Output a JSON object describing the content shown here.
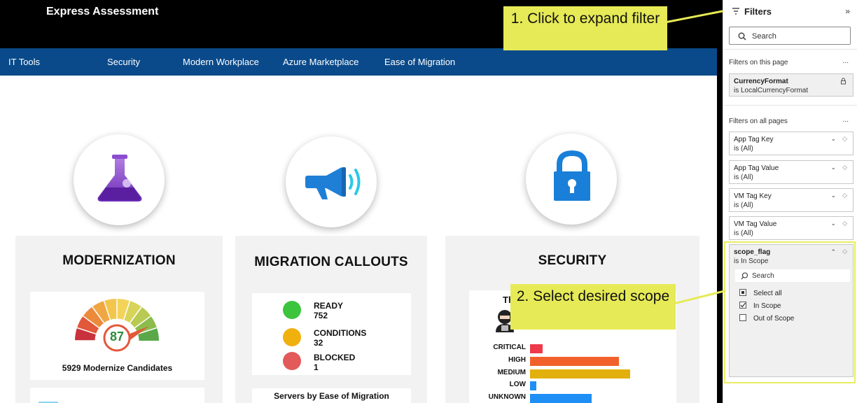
{
  "report": {
    "title": "Express Assessment",
    "nav": [
      "IT Tools",
      "Security",
      "Modern Workplace",
      "Azure Marketplace",
      "Ease of Migration"
    ],
    "modernization": {
      "title": "MODERNIZATION",
      "gauge_value": "87",
      "candidates_label": "5929 Modernize Candidates"
    },
    "migration": {
      "title": "MIGRATION CALLOUTS",
      "items": [
        {
          "label": "READY",
          "value": "752",
          "color": "#3cc43c"
        },
        {
          "label": "CONDITIONS",
          "value": "32",
          "color": "#f0b10f"
        },
        {
          "label": "BLOCKED",
          "value": "1",
          "color": "#e25a5a"
        }
      ],
      "footer": "Servers by Ease of Migration"
    },
    "security": {
      "title": "SECURITY",
      "partial_text": "Th",
      "bars": [
        {
          "label": "CRITICAL",
          "value": 18,
          "color": "#ee3a4b"
        },
        {
          "label": "HIGH",
          "value": 127,
          "color": "#f2612b"
        },
        {
          "label": "MEDIUM",
          "value": 143,
          "color": "#e2b00c"
        },
        {
          "label": "LOW",
          "value": 9,
          "color": "#1f8ef5"
        },
        {
          "label": "UNKNOWN",
          "value": 88,
          "color": "#1f8ef5"
        }
      ]
    },
    "colors": {
      "topbar": "#000000",
      "navbar": "#0a4a8a",
      "card_bg": "#f2f2f2"
    }
  },
  "filters": {
    "title": "Filters",
    "search_label": "Search",
    "section_page": "Filters on this page",
    "section_all": "Filters on all pages",
    "more": "...",
    "page_filters": [
      {
        "name": "CurrencyFormat",
        "value": "is LocalCurrencyFormat"
      }
    ],
    "all_filters": [
      {
        "name": "App Tag Key",
        "value": "is (All)"
      },
      {
        "name": "App Tag Value",
        "value": "is (All)"
      },
      {
        "name": "VM Tag Key",
        "value": "is (All)"
      },
      {
        "name": "VM Tag Value",
        "value": "is (All)"
      }
    ],
    "scope": {
      "name": "scope_flag",
      "value": "is In Scope",
      "search_label": "Search",
      "options": [
        {
          "label": "Select all",
          "state": "partial"
        },
        {
          "label": "In Scope",
          "state": "checked"
        },
        {
          "label": "Out of Scope",
          "state": "unchecked"
        }
      ]
    }
  },
  "callouts": {
    "one": "1. Click to expand filter",
    "two": "2. Select desired scope",
    "color": "#e6ea56"
  },
  "icons": [
    "flask-icon",
    "megaphone-icon",
    "padlock-icon",
    "filter-icon",
    "search-icon",
    "chevron-icon",
    "eraser-icon",
    "lock-icon"
  ]
}
